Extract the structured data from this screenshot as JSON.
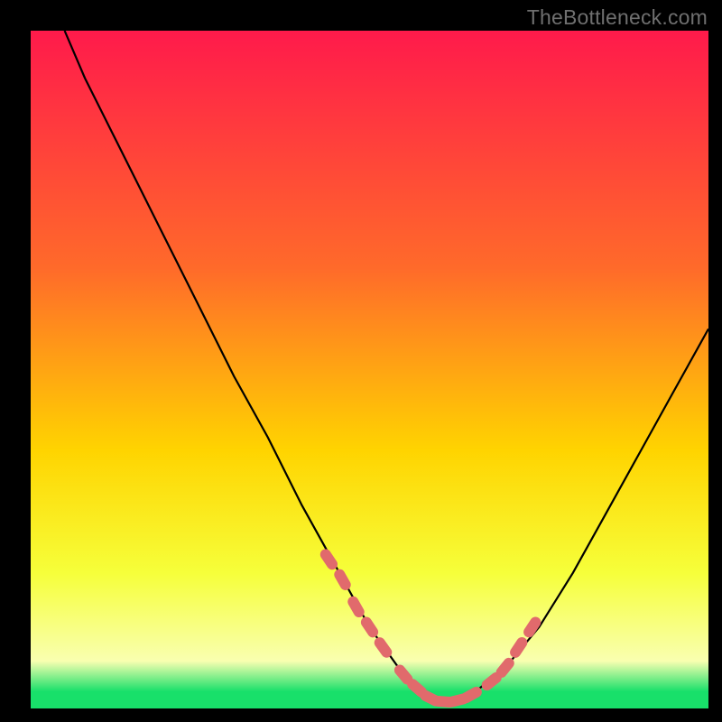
{
  "watermark": "TheBottleneck.com",
  "colors": {
    "top": "#ff1a4b",
    "mid_upper": "#ff6a2a",
    "mid": "#ffd400",
    "mid_lower": "#f6ff3a",
    "pale_band": "#f9ffb0",
    "green": "#18e06a",
    "curve_stroke": "#000000",
    "marker_fill": "#e16a6c",
    "marker_stroke": "#e16a6c"
  },
  "chart_data": {
    "type": "line",
    "title": "",
    "xlabel": "",
    "ylabel": "",
    "xlim": [
      0,
      100
    ],
    "ylim": [
      0,
      100
    ],
    "series": [
      {
        "name": "curve",
        "x": [
          5,
          8,
          12,
          16,
          20,
          25,
          30,
          35,
          40,
          45,
          50,
          55,
          58,
          60,
          62,
          65,
          70,
          75,
          80,
          85,
          90,
          95,
          100
        ],
        "y": [
          100,
          93,
          85,
          77,
          69,
          59,
          49,
          40,
          30,
          21,
          12,
          5,
          2,
          1,
          1,
          2,
          6,
          12,
          20,
          29,
          38,
          47,
          56
        ]
      }
    ],
    "markers": {
      "name": "highlighted-points",
      "x": [
        44,
        46,
        48,
        50,
        52,
        55,
        57,
        59,
        61,
        63,
        65,
        68,
        70,
        72,
        74
      ],
      "y": [
        22,
        19,
        15,
        12,
        9,
        5,
        3,
        1.5,
        1,
        1.2,
        2,
        4,
        6,
        9,
        12
      ]
    },
    "gradient_stops": [
      {
        "offset": 0.0,
        "key": "top"
      },
      {
        "offset": 0.35,
        "key": "mid_upper"
      },
      {
        "offset": 0.62,
        "key": "mid"
      },
      {
        "offset": 0.8,
        "key": "mid_lower"
      },
      {
        "offset": 0.93,
        "key": "pale_band"
      },
      {
        "offset": 0.975,
        "key": "green"
      },
      {
        "offset": 1.0,
        "key": "green"
      }
    ]
  }
}
